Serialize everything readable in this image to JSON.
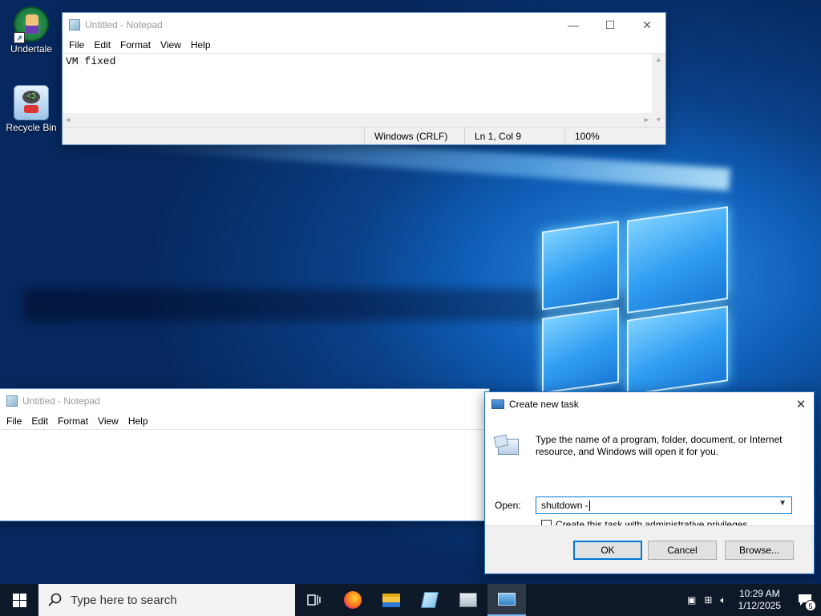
{
  "desktop": {
    "icons": [
      {
        "label": "Undertale"
      },
      {
        "label": "Recycle Bin"
      }
    ]
  },
  "notepad_top": {
    "title": "Untitled - Notepad",
    "menu": [
      "File",
      "Edit",
      "Format",
      "View",
      "Help"
    ],
    "content": "VM fixed",
    "status": {
      "line_ending": "Windows (CRLF)",
      "position": "Ln 1, Col 9",
      "zoom": "100%"
    }
  },
  "notepad_bottom": {
    "title": "Untitled - Notepad",
    "menu": [
      "File",
      "Edit",
      "Format",
      "View",
      "Help"
    ]
  },
  "run_dialog": {
    "title": "Create new task",
    "description": "Type the name of a program, folder, document, or Internet resource, and Windows will open it for you.",
    "open_label": "Open:",
    "open_value": "shutdown -",
    "admin_checkbox_label": "Create this task with administrative privileges.",
    "admin_checked": false,
    "ok_label": "OK",
    "cancel_label": "Cancel",
    "browse_label": "Browse..."
  },
  "taskbar": {
    "search_placeholder": "Type here to search",
    "apps": [
      "task-view-icon",
      "firefox-icon",
      "file-explorer-icon",
      "notepad-icon",
      "task-manager-icon",
      "run-dialog-icon"
    ],
    "clock_time": "10:29 AM",
    "clock_date": "1/12/2025",
    "notification_count": "5"
  },
  "colors": {
    "accent": "#0078d7",
    "taskbar": "#0e1826",
    "desktop": "#0a3f86"
  }
}
